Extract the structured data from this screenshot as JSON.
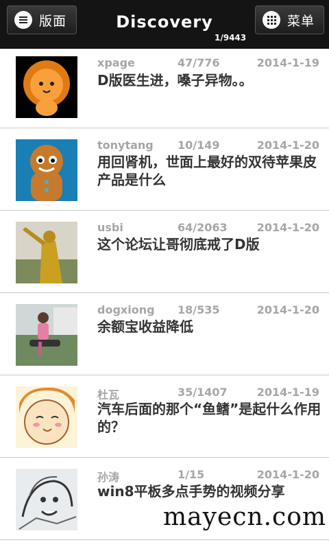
{
  "header": {
    "left_button": {
      "label": "版面",
      "icon": "menu-lines-icon"
    },
    "title": "Discovery",
    "pager": "1/9443",
    "right_button": {
      "label": "菜单",
      "icon": "grid-dots-icon"
    }
  },
  "threads": [
    {
      "author": "xpage",
      "count": "47/776",
      "date": "2014-1-19",
      "subject": "D版医生进，嗓子异物。。",
      "avatar": "orange-lion-cartoon"
    },
    {
      "author": "tonytang",
      "count": "10/149",
      "date": "2014-1-20",
      "subject": "用回肾机，世面上最好的双待苹果皮产品是什么",
      "avatar": "gingerbread-man"
    },
    {
      "author": "usbi",
      "count": "64/2063",
      "date": "2014-1-20",
      "subject": "这个论坛让哥彻底戒了D版",
      "avatar": "golden-statue"
    },
    {
      "author": "dogxiong",
      "count": "18/535",
      "date": "2014-1-20",
      "subject": "余额宝收益降低",
      "avatar": "child-photo"
    },
    {
      "author": "杜瓦",
      "count": "35/1407",
      "date": "2014-1-19",
      "subject": "汽车后面的那个“鱼鳍”是起什么作用的？",
      "avatar": "smiling-girl-cartoon"
    },
    {
      "author": "孙涛",
      "count": "1/15",
      "date": "2014-1-20",
      "subject": "win8平板多点手势的视频分享",
      "avatar": "manga-sketch"
    }
  ],
  "watermark": "mayecn.com"
}
